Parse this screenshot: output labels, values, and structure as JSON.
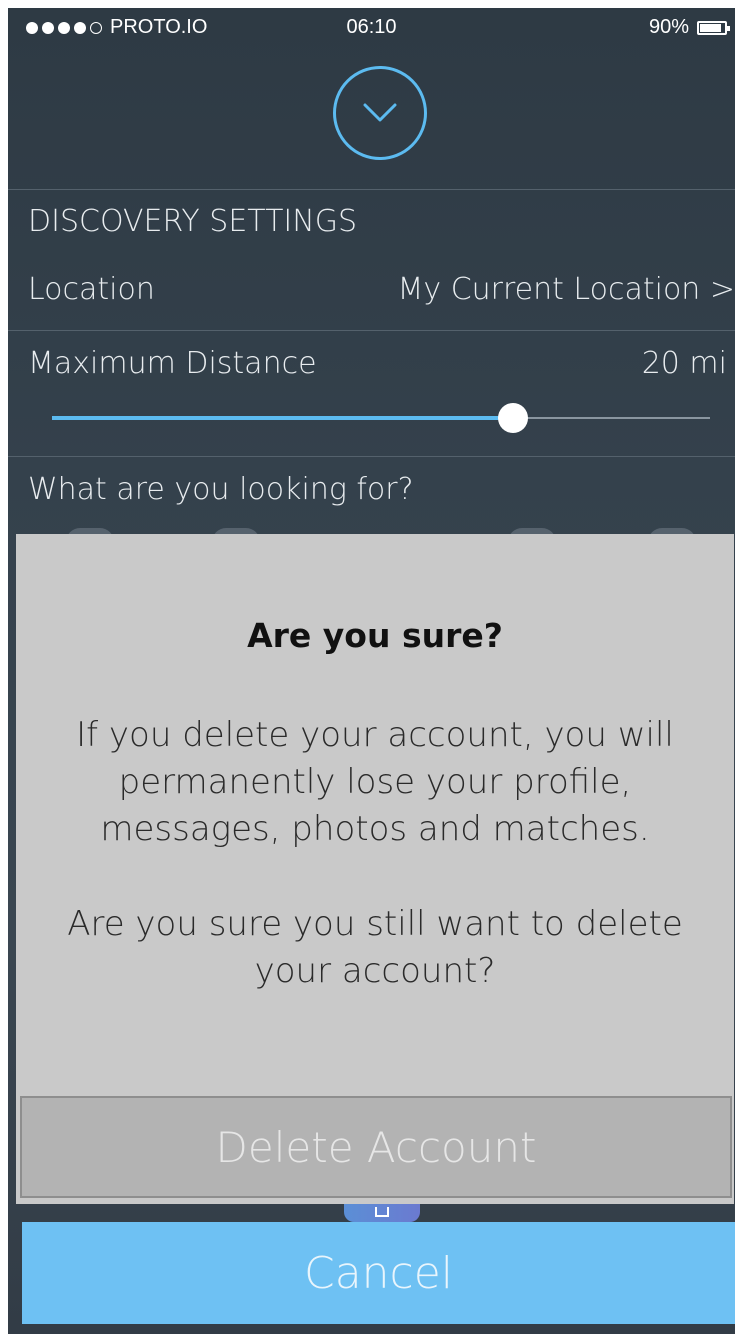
{
  "status_bar": {
    "carrier": "PROTO.IO",
    "signal_bars_filled": 4,
    "signal_bars_total": 5,
    "time": "06:10",
    "battery_percent_label": "90%",
    "battery_level": 0.9
  },
  "header": {
    "collapse_icon": "chevron-down-icon"
  },
  "settings": {
    "section_title": "DISCOVERY SETTINGS",
    "location": {
      "label": "Location",
      "value": "My Current Location >"
    },
    "distance": {
      "label": "Maximum Distance",
      "value": "20 mi",
      "slider_level": 0.7
    },
    "looking_for": {
      "label": "What are you looking for?"
    }
  },
  "modal": {
    "title": "Are you sure?",
    "message": "If you delete your account, you will permanently lose your profile, messages, photos and matches.",
    "confirm_question": "Are you sure you still want to delete your account?",
    "delete_label": "Delete Account",
    "cancel_label": "Cancel"
  },
  "colors": {
    "accent": "#5cbbf0",
    "cancel_button": "#6ec1f3",
    "modal_background": "#c9c9c9",
    "delete_button": "#b3b3b3",
    "screen_background": "#323e49"
  }
}
